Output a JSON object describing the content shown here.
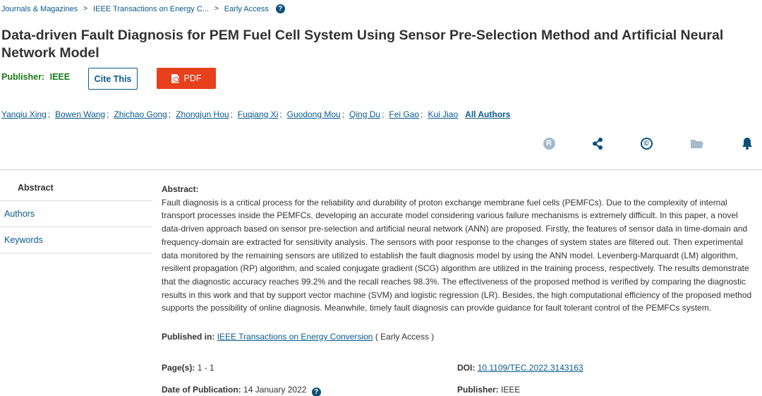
{
  "breadcrumb": {
    "items": [
      "Journals & Magazines",
      "IEEE Transactions on Energy C...",
      "Early Access"
    ],
    "separator": ">"
  },
  "article": {
    "title": "Data-driven Fault Diagnosis for PEM Fuel Cell System Using Sensor Pre-Selection Method and Artificial Neural Network Model",
    "publisher_label": "Publisher:",
    "publisher_value": "IEEE"
  },
  "buttons": {
    "cite": "Cite This",
    "pdf": "PDF"
  },
  "authors": {
    "names": [
      "Yanqiu Xing",
      "Bowen Wang",
      "Zhichao Gong",
      "Zhongjun Hou",
      "Fuqiang Xi",
      "Guodong Mou",
      "Qing Du",
      "Fei Gao",
      "Kui Jiao"
    ],
    "separator": ";",
    "all_label": "All Authors"
  },
  "toolbar": {
    "rights_glyph": "R",
    "copyright_glyph": "©",
    "icons": [
      "rights-icon",
      "share-icon",
      "copyright-icon",
      "folder-icon",
      "bell-icon"
    ]
  },
  "nav": {
    "items": [
      "Abstract",
      "Authors",
      "Keywords"
    ]
  },
  "abstract": {
    "label": "Abstract:",
    "text": "Fault diagnosis is a critical process for the reliability and durability of proton exchange membrane fuel cells (PEMFCs). Due to the complexity of internal transport processes inside the PEMFCs, developing an accurate model considering various failure mechanisms is extremely difficult. In this paper, a novel data-driven approach based on sensor pre-selection and artificial neural network (ANN) are proposed. Firstly, the features of sensor data in time-domain and frequency-domain are extracted for sensitivity analysis. The sensors with poor response to the changes of system states are filtered out. Then experimental data monitored by the remaining sensors are utilized to establish the fault diagnosis model by using the ANN model. Levenberg-Marquardt (LM) algorithm, resilient propagation (RP) algorithm, and scaled conjugate gradient (SCG) algorithm are utilized in the training process, respectively. The results demonstrate that the diagnostic accuracy reaches 99.2% and the recall reaches 98.3%. The effectiveness of the proposed method is verified by comparing the diagnostic results in this work and that by support vector machine (SVM) and logistic regression (LR). Besides, the high computational efficiency of the proposed method supports the possibility of online diagnosis. Meanwhile, timely fault diagnosis can provide guidance for fault tolerant control of the PEMFCs system."
  },
  "meta": {
    "published_in_label": "Published in:",
    "published_in_value": "IEEE Transactions on Energy Conversion",
    "published_in_suffix": "( Early Access )",
    "pages_label": "Page(s):",
    "pages_value": "1 - 1",
    "doi_label": "DOI:",
    "doi_value": "10.1109/TEC.2022.3143163",
    "date_label": "Date of Publication:",
    "date_value": "14 January 2022",
    "publisher_label": "Publisher:",
    "publisher_value": "IEEE",
    "help_glyph": "?"
  },
  "colors": {
    "link": "#0a5a8c",
    "publisher_green": "#1a7a1a",
    "pdf_button": "#e8401c",
    "icon_blue": "#0b4f79",
    "rights_gray": "#a7bac9"
  }
}
